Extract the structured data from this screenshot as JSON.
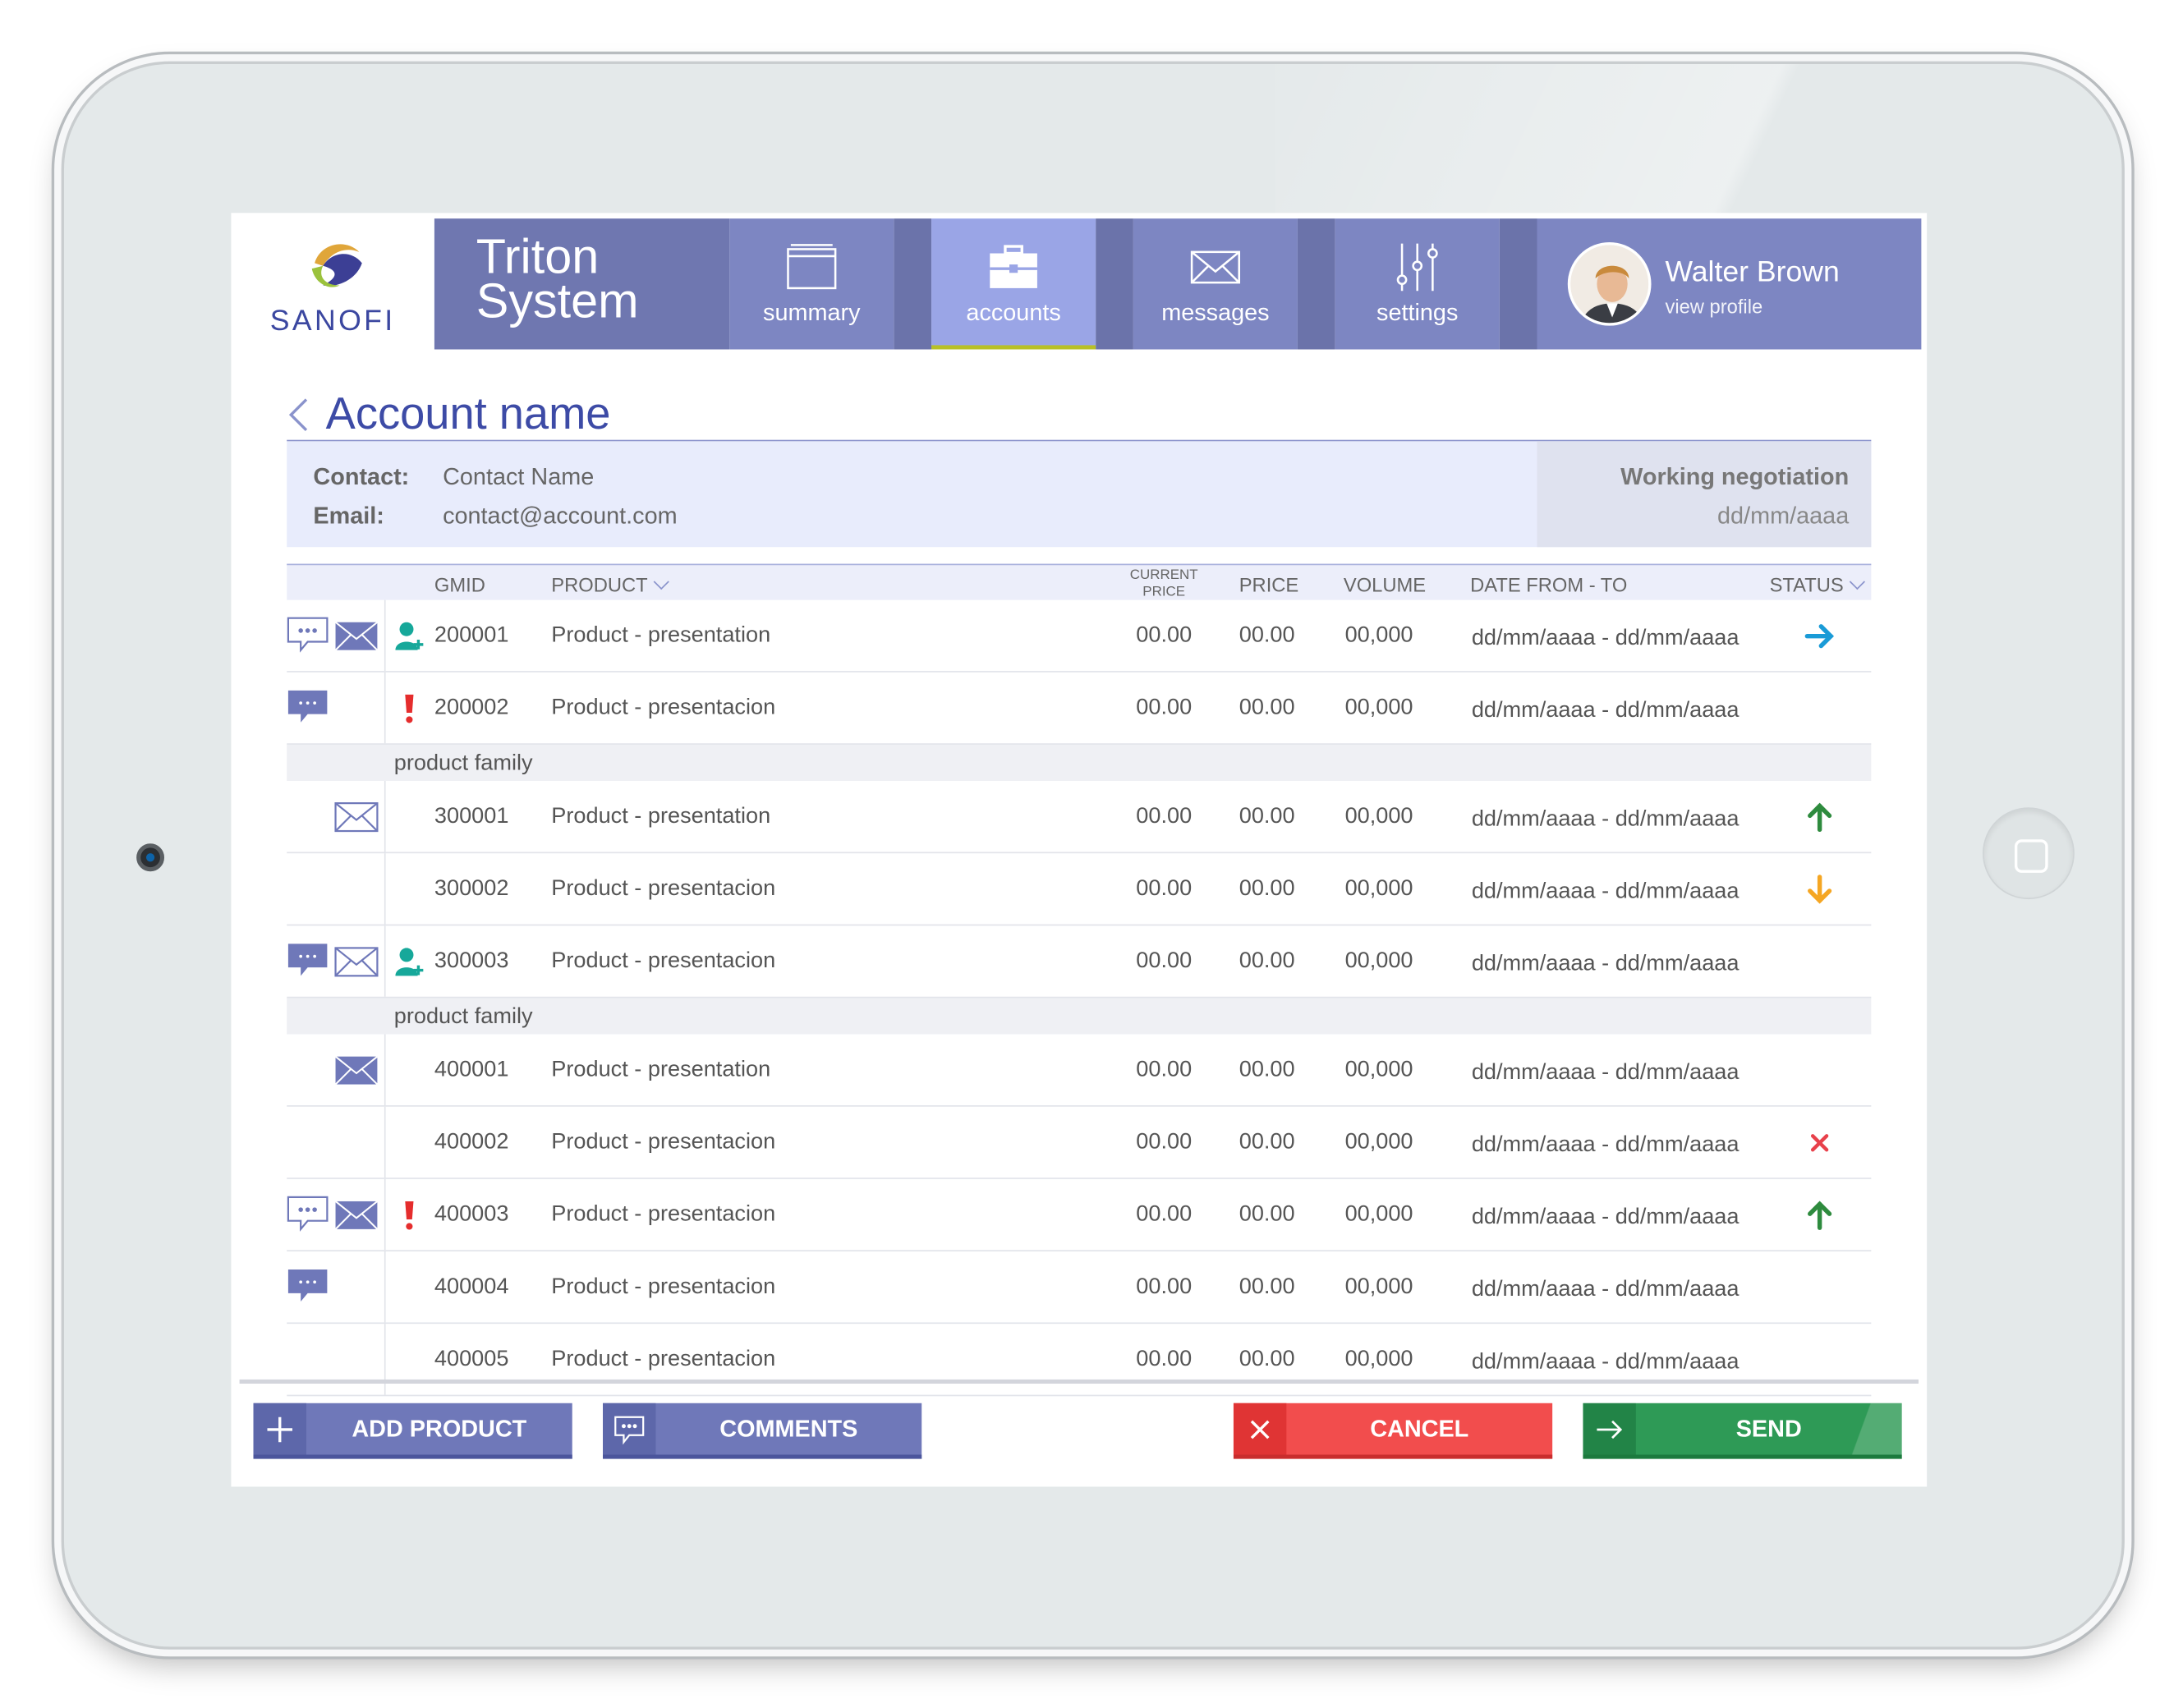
{
  "brand": {
    "logo_text": "SANOFI",
    "system_line1": "Triton",
    "system_line2": "System"
  },
  "nav": [
    {
      "label": "summary",
      "icon": "window-icon"
    },
    {
      "label": "accounts",
      "icon": "briefcase-icon"
    },
    {
      "label": "messages",
      "icon": "envelope-icon"
    },
    {
      "label": "settings",
      "icon": "sliders-icon"
    }
  ],
  "user": {
    "name": "Walter Brown",
    "link": "view profile"
  },
  "account": {
    "title": "Account name",
    "contact_label": "Contact:",
    "contact_value": "Contact Name",
    "email_label": "Email:",
    "email_value": "contact@account.com",
    "negotiation_label": "Working negotiation",
    "negotiation_date": "dd/mm/aaaa"
  },
  "table": {
    "headers": {
      "gmid": "GMID",
      "product": "PRODUCT",
      "current_price": "CURRENT PRICE",
      "price": "PRICE",
      "volume": "VOLUME",
      "date": "DATE FROM - TO",
      "status": "STATUS"
    },
    "sections": [
      {
        "family": "",
        "rows": [
          {
            "comment": "outline",
            "mail": true,
            "flag": "person",
            "gmid": "200001",
            "product": "Product - presentation",
            "current": "00.00",
            "price": "00.00",
            "volume": "00,000",
            "date": "dd/mm/aaaa - dd/mm/aaaa",
            "status": "right"
          },
          {
            "comment": "filled",
            "mail": false,
            "flag": "alert",
            "gmid": "200002",
            "product": "Product - presentacion",
            "current": "00.00",
            "price": "00.00",
            "volume": "00,000",
            "date": "dd/mm/aaaa - dd/mm/aaaa",
            "status": ""
          }
        ]
      },
      {
        "family": "product family",
        "rows": [
          {
            "comment": "",
            "mail": "outline",
            "flag": "",
            "gmid": "300001",
            "product": "Product - presentation",
            "current": "00.00",
            "price": "00.00",
            "volume": "00,000",
            "date": "dd/mm/aaaa - dd/mm/aaaa",
            "status": "up"
          },
          {
            "comment": "",
            "mail": false,
            "flag": "",
            "gmid": "300002",
            "product": "Product - presentacion",
            "current": "00.00",
            "price": "00.00",
            "volume": "00,000",
            "date": "dd/mm/aaaa - dd/mm/aaaa",
            "status": "down"
          },
          {
            "comment": "filled",
            "mail": "outline",
            "flag": "person",
            "gmid": "300003",
            "product": "Product - presentacion",
            "current": "00.00",
            "price": "00.00",
            "volume": "00,000",
            "date": "dd/mm/aaaa - dd/mm/aaaa",
            "status": ""
          }
        ]
      },
      {
        "family": "product family",
        "rows": [
          {
            "comment": "",
            "mail": true,
            "flag": "",
            "gmid": "400001",
            "product": "Product - presentation",
            "current": "00.00",
            "price": "00.00",
            "volume": "00,000",
            "date": "dd/mm/aaaa - dd/mm/aaaa",
            "status": ""
          },
          {
            "comment": "",
            "mail": false,
            "flag": "",
            "gmid": "400002",
            "product": "Product - presentacion",
            "current": "00.00",
            "price": "00.00",
            "volume": "00,000",
            "date": "dd/mm/aaaa - dd/mm/aaaa",
            "status": "rejected"
          },
          {
            "comment": "outline",
            "mail": true,
            "flag": "alert",
            "gmid": "400003",
            "product": "Product - presentacion",
            "current": "00.00",
            "price": "00.00",
            "volume": "00,000",
            "date": "dd/mm/aaaa - dd/mm/aaaa",
            "status": "up"
          },
          {
            "comment": "filled",
            "mail": false,
            "flag": "",
            "gmid": "400004",
            "product": "Product - presentacion",
            "current": "00.00",
            "price": "00.00",
            "volume": "00,000",
            "date": "dd/mm/aaaa - dd/mm/aaaa",
            "status": ""
          },
          {
            "comment": "",
            "mail": false,
            "flag": "",
            "gmid": "400005",
            "product": "Product - presentacion",
            "current": "00.00",
            "price": "00.00",
            "volume": "00,000",
            "date": "dd/mm/aaaa - dd/mm/aaaa",
            "status": ""
          }
        ]
      }
    ]
  },
  "actions": {
    "add_product": "ADD PRODUCT",
    "comments": "COMMENTS",
    "cancel": "CANCEL",
    "send": "SEND"
  },
  "colors": {
    "nav": "#7d86c2",
    "nav_active": "#9aa5e6",
    "brand_blue": "#3d4ba6",
    "status_right": "#1a9bd7",
    "status_up": "#2e8b3e",
    "status_down": "#f5a623",
    "status_rejected": "#e8414b",
    "alert": "#e52d2d",
    "person": "#16a89a",
    "cancel": "#f24d4d",
    "send": "#2e9a56"
  }
}
